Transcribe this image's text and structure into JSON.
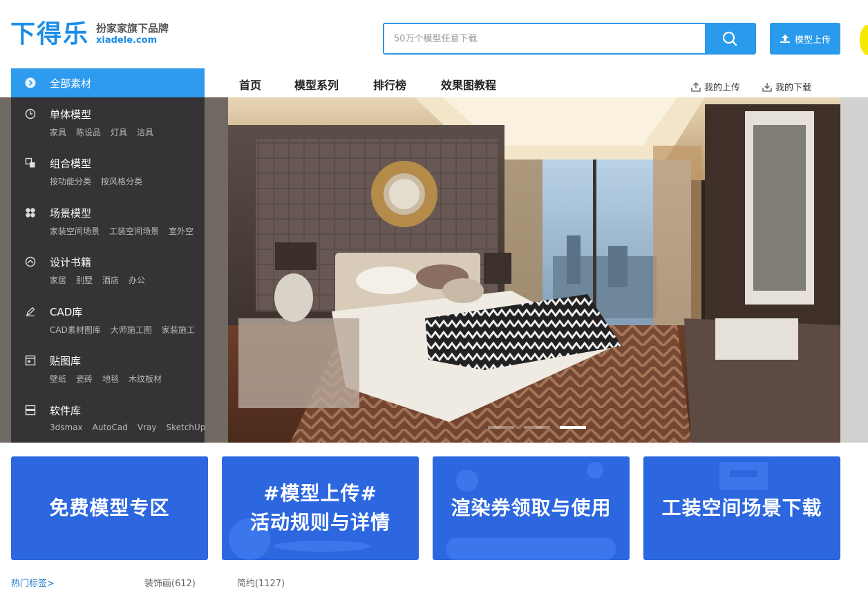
{
  "logo": {
    "mark": "下得乐",
    "slogan": "扮家家旗下品牌",
    "domain": "xiadele.com"
  },
  "search": {
    "placeholder": "50万个模型任意下载"
  },
  "upload_button": {
    "label": "模型上传"
  },
  "nav": {
    "items": [
      "首页",
      "模型系列",
      "排行榜",
      "效果图教程"
    ]
  },
  "user_links": {
    "upload": "我的上传",
    "download": "我的下载"
  },
  "sidebar": {
    "header": "全部素材",
    "categories": [
      {
        "title": "单体模型",
        "subs": [
          "家具",
          "陈设品",
          "灯具",
          "洁具"
        ]
      },
      {
        "title": "组合模型",
        "subs": [
          "按功能分类",
          "按风格分类"
        ]
      },
      {
        "title": "场景模型",
        "subs": [
          "家装空间场景",
          "工装空间场景",
          "室外空"
        ]
      },
      {
        "title": "设计书籍",
        "subs": [
          "家居",
          "别墅",
          "酒店",
          "办公"
        ]
      },
      {
        "title": "CAD库",
        "subs": [
          "CAD素材图库",
          "大师施工图",
          "家装施工"
        ]
      },
      {
        "title": "贴图库",
        "subs": [
          "壁纸",
          "瓷砖",
          "地毯",
          "木纹板材"
        ]
      },
      {
        "title": "软件库",
        "subs": [
          "3dsmax",
          "AutoCad",
          "Vray",
          "SketchUp"
        ]
      }
    ]
  },
  "carousel": {
    "slide_count": 3,
    "active_slide": 3
  },
  "promos": [
    {
      "line1": "免费模型专区",
      "line2": ""
    },
    {
      "line1": "#模型上传#",
      "line2": "活动规则与详情"
    },
    {
      "line1": "渲染券领取与使用",
      "line2": ""
    },
    {
      "line1": "工装空间场景下载",
      "line2": ""
    }
  ],
  "tags": {
    "hot": "热门标签>",
    "t1": "装饰画(612)",
    "t2": "简约(1127)"
  },
  "colors": {
    "brand": "#1b8de6",
    "accent": "#2a9aec",
    "promo": "#2c67df"
  }
}
